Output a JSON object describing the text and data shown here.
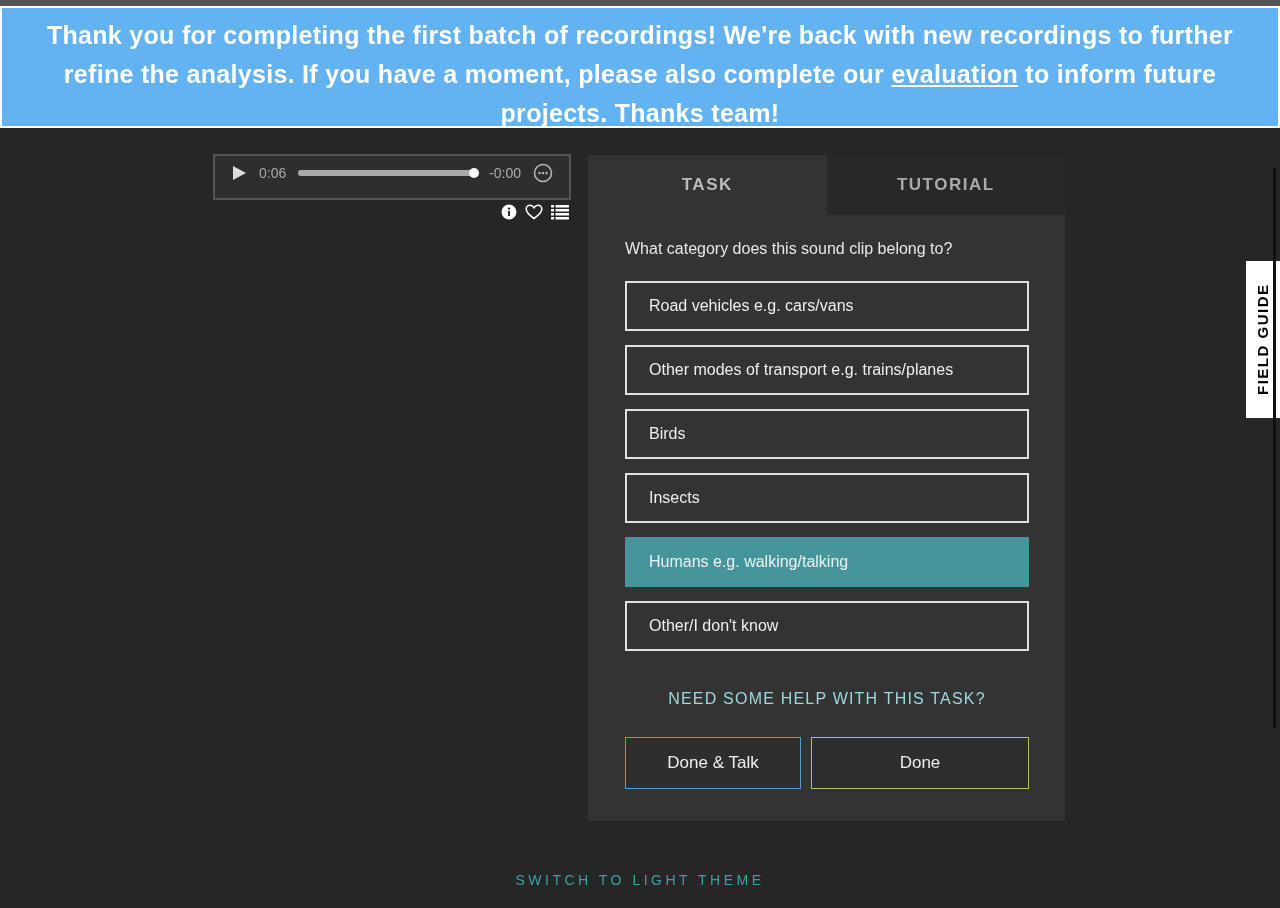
{
  "banner": {
    "text_before": "Thank you for completing the first batch of recordings! We're back with new recordings to further refine the analysis. If you have a moment, please also complete our",
    "link": "evaluation",
    "text_after": "to inform future projects. Thanks team!"
  },
  "player": {
    "elapsed": "0:06",
    "remaining": "-0:00",
    "level": 0.98
  },
  "tabs": [
    {
      "label": "TASK",
      "selected": true
    },
    {
      "label": "TUTORIAL",
      "selected": false
    }
  ],
  "question": "What category does this sound clip belong to?",
  "options": [
    {
      "label": "Road vehicles e.g. cars/vans",
      "selected": false
    },
    {
      "label": "Other modes of transport e.g. trains/planes",
      "selected": false
    },
    {
      "label": "Birds",
      "selected": false
    },
    {
      "label": "Insects",
      "selected": false
    },
    {
      "label": "Humans e.g. walking/talking",
      "selected": true
    },
    {
      "label": "Other/I don't know",
      "selected": false
    }
  ],
  "help_link": "NEED SOME HELP WITH THIS TASK?",
  "buttons": [
    {
      "label": "Done & Talk",
      "kind": "talk"
    },
    {
      "label": "Done",
      "kind": "done"
    }
  ],
  "field_guide": "FIELD GUIDE",
  "theme_link": "SWITCH TO LIGHT THEME"
}
